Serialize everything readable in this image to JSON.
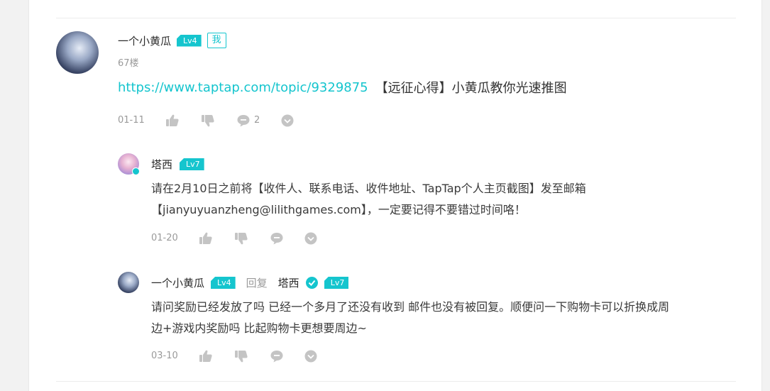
{
  "main_comment": {
    "username": "一个小黄瓜",
    "level": "Lv4",
    "me_badge": "我",
    "floor": "67楼",
    "link_text": "https://www.taptap.com/topic/9329875",
    "text": "【远征心得】小黄瓜教你光速推图",
    "date": "01-11",
    "reply_count": "2"
  },
  "reply1": {
    "username": "塔西",
    "level": "Lv7",
    "line1": "请在2月10日之前将【收件人、联系电话、收件地址、TapTap个人主页截图】发至邮箱",
    "line2": "【jianyuyuanzheng@lilithgames.com】，一定要记得不要错过时间咯！",
    "date": "01-20"
  },
  "reply2": {
    "username": "一个小黄瓜",
    "level": "Lv4",
    "reply_label": "回复",
    "target_username": "塔西",
    "target_level": "Lv7",
    "line1": "请问奖励已经发放了吗 已经一个多月了还没有收到 邮件也没有被回复。顺便问一下购物卡可以折换成周",
    "line2": "边+游戏内奖励吗 比起购物卡更想要周边~",
    "date": "03-10"
  },
  "colors": {
    "accent": "#15c5ce",
    "icon_grey": "#c4c4c4",
    "meta_grey": "#9a9a9a"
  },
  "icons": [
    "thumb-up-icon",
    "thumb-down-icon",
    "comment-icon",
    "chevron-down-icon",
    "verified-icon"
  ]
}
